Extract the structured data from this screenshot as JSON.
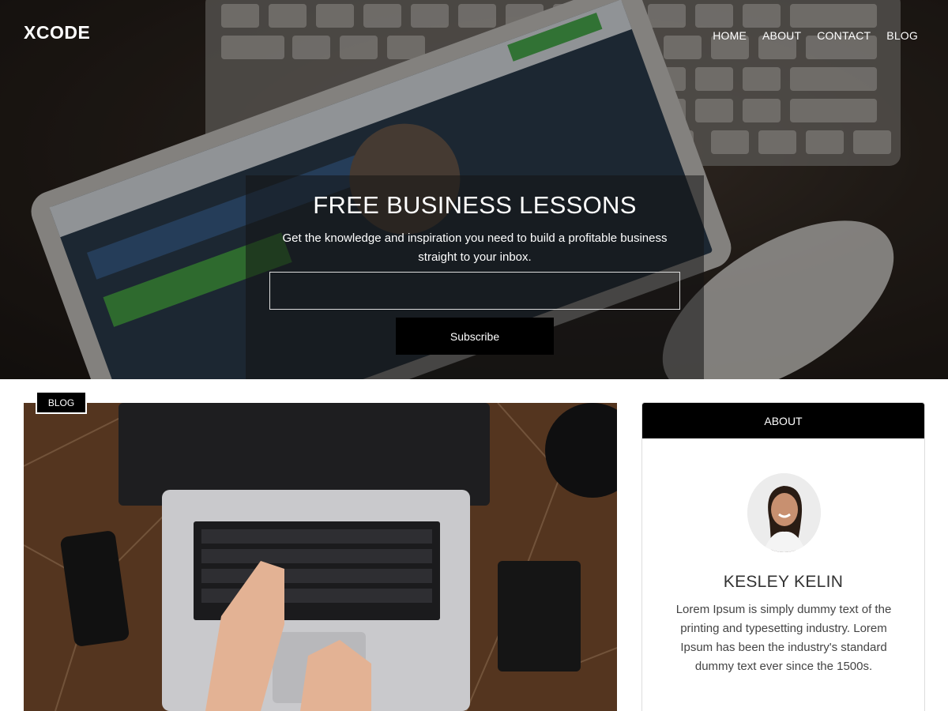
{
  "header": {
    "brand": "XCODE",
    "nav": [
      "HOME",
      "ABOUT",
      "CONTACT",
      "BLOG"
    ]
  },
  "hero": {
    "title": "FREE BUSINESS LESSONS",
    "subtitle": "Get the knowledge and inspiration you need to build a profitable business straight to your inbox.",
    "email_placeholder": "",
    "button_label": "Subscribe"
  },
  "post": {
    "category_badge": "BLOG"
  },
  "sidebar": {
    "widget_title": "ABOUT",
    "author_name": "KESLEY KELIN",
    "author_bio": "Lorem Ipsum is simply dummy text of the printing and typesetting industry. Lorem Ipsum has been the industry's standard dummy text ever since the 1500s."
  },
  "colors": {
    "accent": "#000000",
    "text": "#333333",
    "border": "#dddddd"
  }
}
